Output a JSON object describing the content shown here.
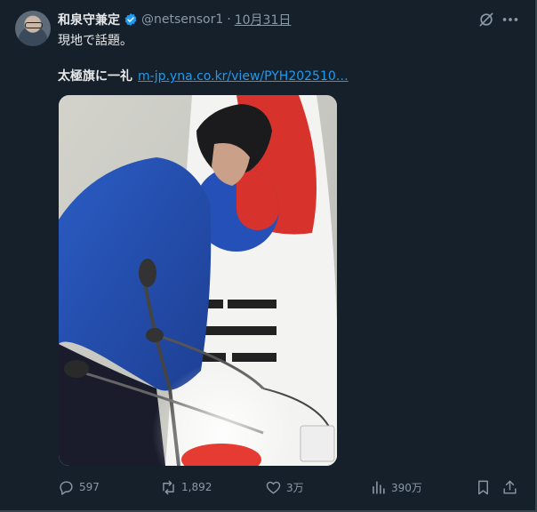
{
  "tweet": {
    "display_name": "和泉守兼定",
    "handle": "@netsensor1",
    "separator": "·",
    "date": "10月31日",
    "text_line1": "現地で話題。",
    "text_line2_bold": "太極旗に一礼",
    "link_text": "m-jp.yna.co.kr/view/PYH202510…"
  },
  "icons": {
    "verified": "verified-badge-icon",
    "grok": "grok-icon",
    "more": "more-options-icon",
    "reply": "reply-icon",
    "retweet": "retweet-icon",
    "like": "like-icon",
    "views": "views-icon",
    "bookmark": "bookmark-icon",
    "share": "share-icon"
  },
  "actions": {
    "replies": "597",
    "retweets": "1,892",
    "likes": "3万",
    "views": "390万"
  },
  "colors": {
    "background": "#15202b",
    "text": "#e7e9ea",
    "muted": "#8b98a5",
    "link": "#1d9bf0",
    "verified": "#1d9bf0"
  }
}
